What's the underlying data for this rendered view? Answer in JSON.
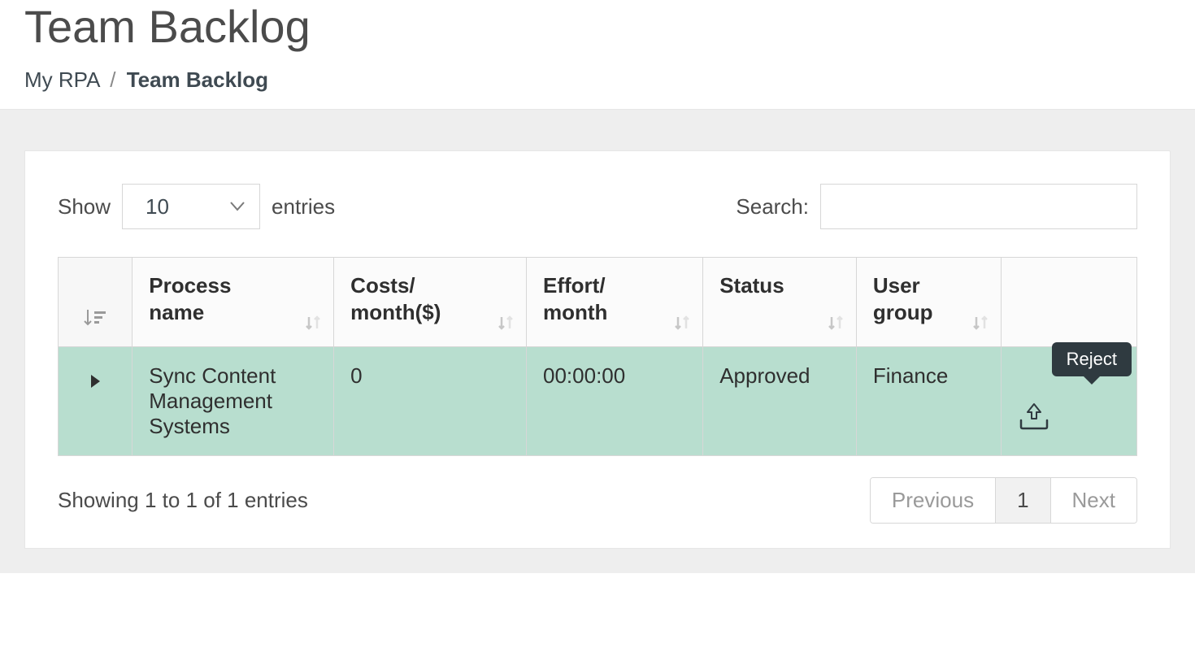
{
  "header": {
    "title": "Team Backlog",
    "breadcrumb": {
      "root": "My RPA",
      "current": "Team Backlog"
    }
  },
  "controls": {
    "show_label_pre": "Show",
    "show_label_post": "entries",
    "entries_value": "10",
    "search_label": "Search:"
  },
  "table": {
    "columns": {
      "process_name": "Process name",
      "costs": "Costs/ month($)",
      "effort": "Effort/ month",
      "status": "Status",
      "user_group": "User group"
    },
    "rows": [
      {
        "process_name": "Sync Content Management Systems",
        "costs": "0",
        "effort": "00:00:00",
        "status": "Approved",
        "user_group": "Finance"
      }
    ]
  },
  "tooltip": {
    "reject": "Reject"
  },
  "footer": {
    "info": "Showing 1 to 1 of 1 entries",
    "prev": "Previous",
    "page": "1",
    "next": "Next"
  }
}
